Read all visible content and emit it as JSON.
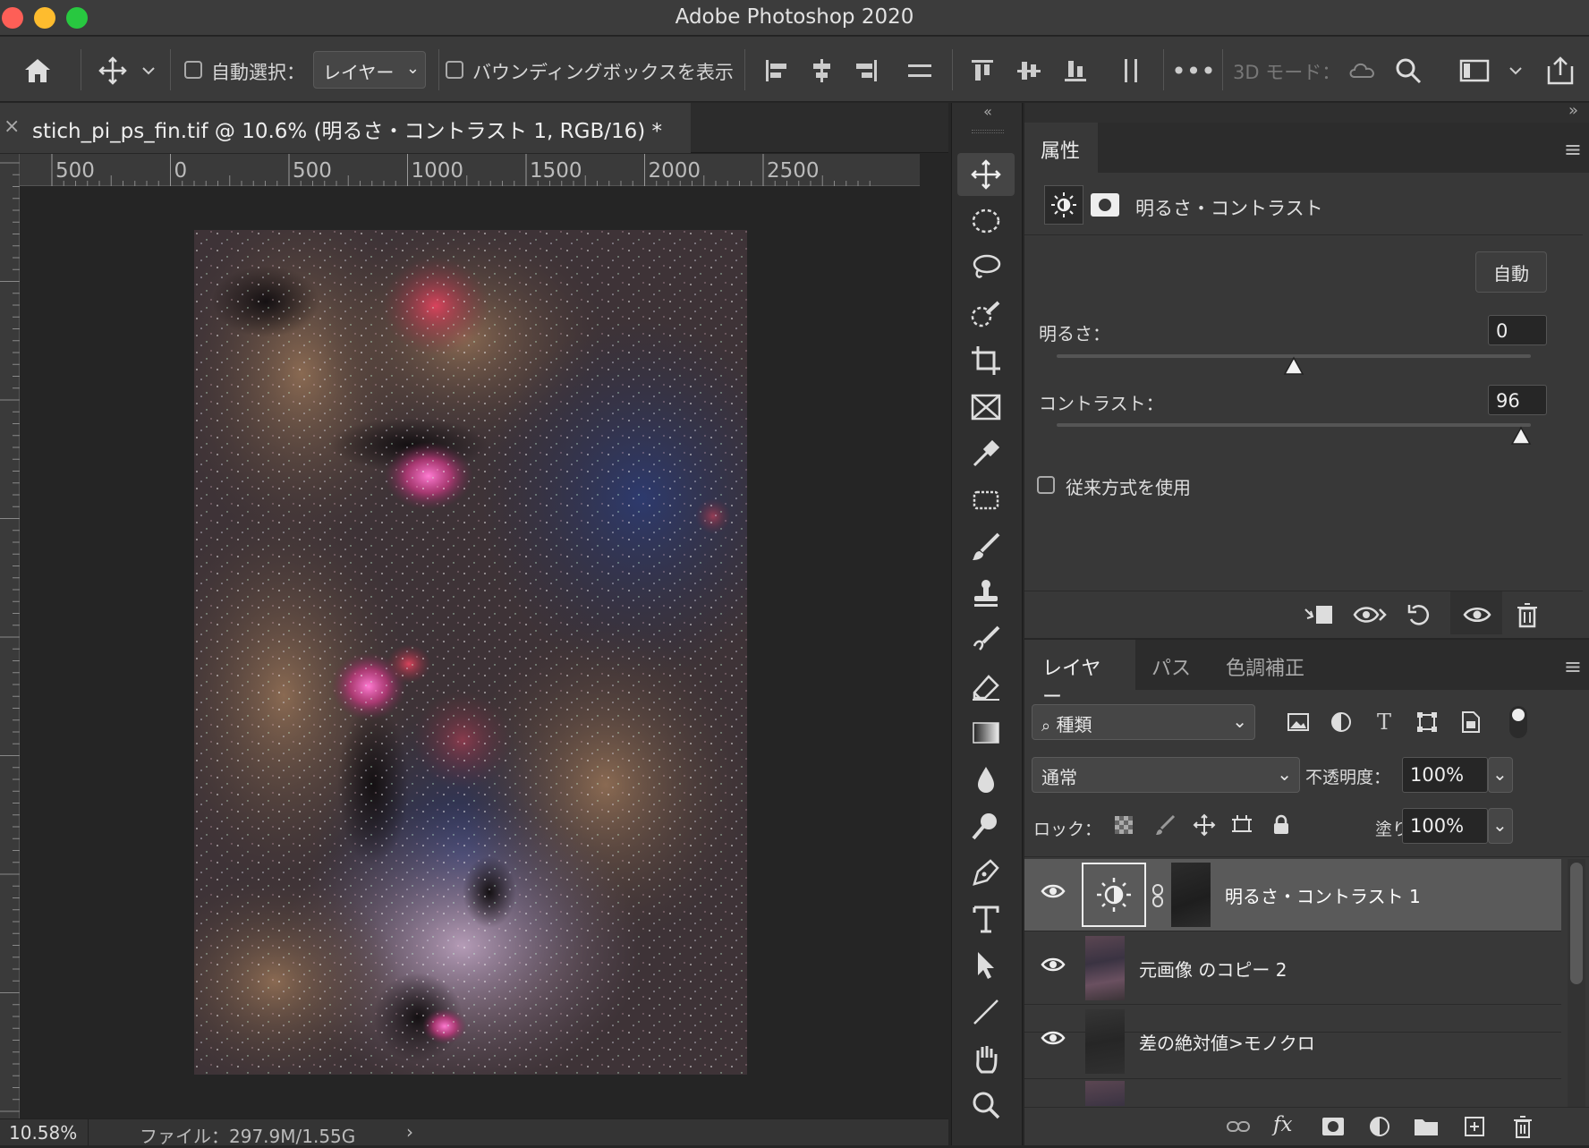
{
  "app": {
    "title": "Adobe Photoshop 2020"
  },
  "options_bar": {
    "auto_select_label": "自動選択：",
    "auto_select_target": "レイヤー",
    "show_bbox_label": "バウンディングボックスを表示",
    "mode_3d_label": "3D モード："
  },
  "document": {
    "tab_title": "stich_pi_ps_fin.tif @ 10.6% (明るさ・コントラスト 1, RGB/16) *",
    "ruler_labels": [
      "500",
      "0",
      "500",
      "1000",
      "1500",
      "2000",
      "2500"
    ]
  },
  "status": {
    "zoom": "10.58%",
    "file_info": "ファイル：297.9M/1.55G"
  },
  "properties": {
    "tab_label": "属性",
    "adjustment_name": "明るさ・コントラスト",
    "auto_button": "自動",
    "brightness_label": "明るさ：",
    "brightness_value": "0",
    "brightness_fraction": 0.5,
    "contrast_label": "コントラスト：",
    "contrast_value": "96",
    "contrast_fraction": 0.98,
    "legacy_label": "従来方式を使用"
  },
  "layers_panel": {
    "tabs": [
      "レイヤー",
      "パス",
      "色調補正"
    ],
    "filter_kind": "種類",
    "blend_mode": "通常",
    "opacity_label": "不透明度：",
    "opacity_value": "100%",
    "lock_label": "ロック：",
    "fill_label": "塗り：",
    "fill_value": "100%",
    "layers": [
      {
        "name": "明るさ・コントラスト 1",
        "selected": true
      },
      {
        "name": "元画像 のコピー 2",
        "selected": false
      },
      {
        "name": "差の絶対値>モノクロ",
        "selected": false
      }
    ]
  },
  "colors": {
    "accent_selected_row": "#5a5a5a",
    "close_light": "#fe5f57",
    "min_light": "#febc2e",
    "max_light": "#28c840"
  },
  "icons": [
    "home-icon",
    "move-icon",
    "align-left-icon",
    "align-center-icon",
    "align-right-icon",
    "distribute-icon",
    "more-icon",
    "search-icon",
    "share-icon",
    "brightness-icon",
    "mask-icon",
    "eye-icon",
    "trash-icon",
    "link-icon",
    "fx-icon",
    "new-layer-icon",
    "folder-icon"
  ]
}
